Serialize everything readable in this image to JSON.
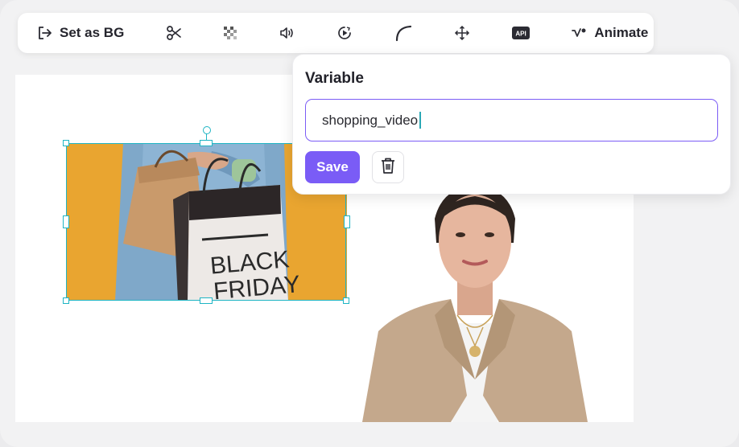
{
  "toolbar": {
    "set_as_bg_label": "Set as BG",
    "animate_label": "Animate",
    "api_icon_text": "API",
    "icons": [
      "exit-arrow-icon",
      "scissors-icon",
      "checkerboard-icon",
      "speaker-icon",
      "play-circle-icon",
      "corner-curve-icon",
      "move-arrows-icon",
      "api-icon",
      "animate-wand-icon"
    ]
  },
  "popover": {
    "title": "Variable",
    "input_value": "shopping_video",
    "save_label": "Save",
    "delete_icon": "trash-icon"
  },
  "canvas": {
    "image_text": [
      "BLACK",
      "FRIDAY"
    ],
    "colors": {
      "selection": "#1fb5c4",
      "accent": "#7a5cf6",
      "image_bg": "#e8a22d"
    }
  }
}
